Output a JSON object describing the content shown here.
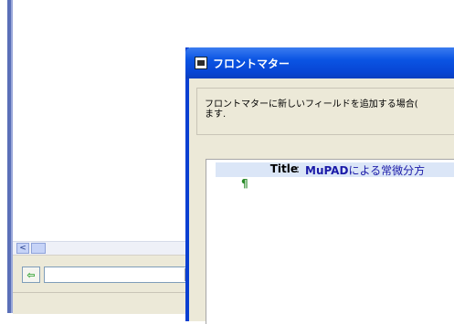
{
  "background_window": {
    "scroll_left_arrow": "<",
    "nav_back_symbol": "⇦",
    "combo_value": "",
    "combo_arrow": "▼"
  },
  "dialog": {
    "title": "フロントマター",
    "description_line1": "フロントマターに新しいフィールドを追加する場合(",
    "description_line2": "ます.",
    "editor": {
      "field_label": "Title",
      "field_separator": ":",
      "field_value_bold": "MuPAD",
      "field_value_rest": "による常微分方",
      "pilcrow": "¶"
    }
  },
  "colors": {
    "titlebar": "#0a54e3",
    "field_value": "#1a1aa8",
    "pilcrow": "#2a8a2a",
    "field_highlight": "#dbe6f7"
  }
}
